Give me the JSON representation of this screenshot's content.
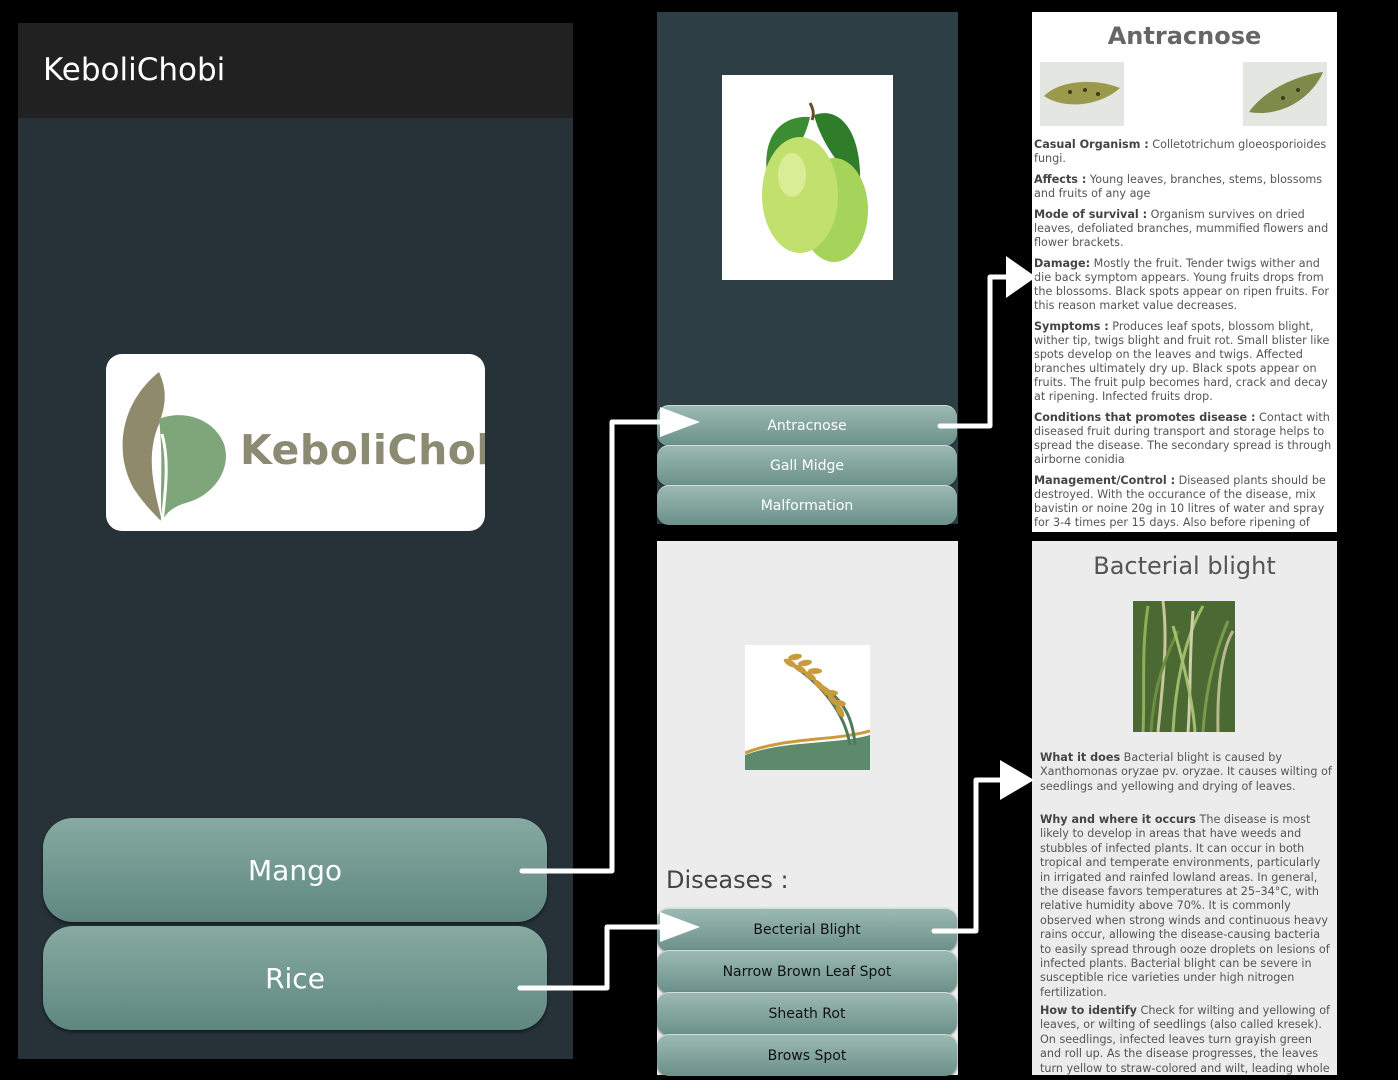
{
  "main": {
    "app_title": "KeboliChobi",
    "logo_text": "KeboliChobi",
    "buttons": [
      "Mango",
      "Rice"
    ]
  },
  "mango_screen": {
    "buttons": [
      "Antracnose",
      "Gall Midge",
      "Malformation"
    ]
  },
  "rice_screen": {
    "label": "Diseases :",
    "buttons": [
      "Becterial Blight",
      "Narrow Brown Leaf Spot",
      "Sheath Rot",
      "Brows Spot"
    ]
  },
  "antracnose": {
    "title": "Antracnose",
    "sections": [
      {
        "label": "Casual Organism :",
        "text": " Colletotrichum gloeosporioides fungi."
      },
      {
        "label": "Affects :",
        "text": " Young leaves, branches, stems, blossoms and fruits of any age"
      },
      {
        "label": "Mode of survival :",
        "text": " Organism survives on dried leaves, defoliated branches, mummified flowers and flower brackets."
      },
      {
        "label": "Damage:",
        "text": " Mostly the fruit. Tender twigs wither and die back symptom appears. Young fruits drops from the blossoms. Black spots appear on ripen fruits. For this reason market value decreases."
      },
      {
        "label": " Symptoms :",
        "text": " Produces leaf spots, blossom blight, wither tip, twigs blight and fruit rot. Small blister like spots develop on the leaves and twigs. Affected branches ultimately dry up. Black spots appear on fruits. The fruit pulp becomes hard, crack and decay at ripening. Infected fruits drop."
      },
      {
        "label": " Conditions that promotes disease :",
        "text": " Contact with diseased fruit during transport and storage helps to spread the disease. The secondary spread is through airborne conidia"
      },
      {
        "label": " Management/Control :",
        "text": " Diseased plants should be destroyed. With the occurance of the disease, mix bavistin or noine 20g in 10 litres of water and spray for 3-4 times per 15 days. Also before ripening of mango"
      }
    ]
  },
  "bacterial_blight": {
    "title": "Bacterial blight",
    "sections": [
      {
        "label": "What it does",
        "text": " Bacterial blight is caused by Xanthomonas oryzae pv. oryzae. It causes wilting of seedlings and yellowing and drying of leaves."
      },
      {
        "label": " Why and where it occurs",
        "text": " The disease is most likely to develop in areas that have weeds and stubbles of infected plants. It can occur in both tropical and temperate environments, particularly in irrigated and rainfed lowland areas. In general, the disease favors temperatures at 25–34°C, with relative humidity above 70%. It is commonly observed when strong winds and continuous heavy rains occur, allowing the disease-causing bacteria to easily spread through ooze droplets on lesions of infected plants. Bacterial blight can be severe in susceptible rice varieties under high nitrogen fertilization."
      },
      {
        "label": " How to identify",
        "text": " Check for wilting and yellowing of leaves, or wilting of seedlings (also called kresek). On seedlings, infected leaves turn grayish green and roll up. As the disease progresses, the leaves turn yellow to straw-colored and wilt, leading whole seedlings to"
      }
    ]
  },
  "colors": {
    "main_bg": "#263238",
    "appbar": "#212121",
    "button_teal": "#6f958e",
    "connector": "#ffffff"
  }
}
